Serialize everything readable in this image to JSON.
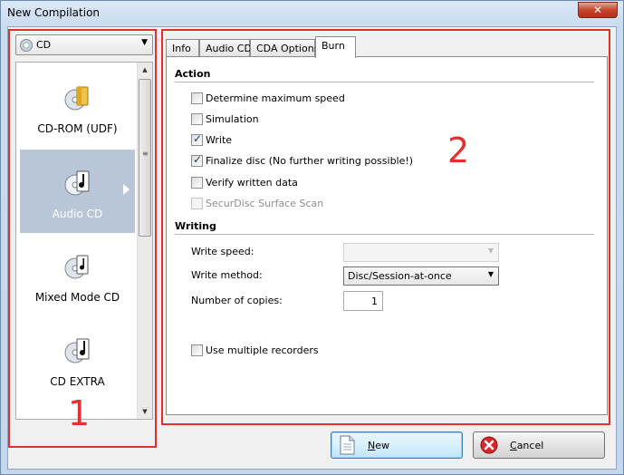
{
  "window": {
    "title": "New Compilation",
    "close_glyph": "✕"
  },
  "disc_type": {
    "selected": "CD",
    "icon": "disc-icon"
  },
  "categories": [
    {
      "label": "CD-ROM (UDF)",
      "icon": "cd-folder-icon"
    },
    {
      "label": "Audio CD",
      "icon": "cd-music-note-icon",
      "selected": true
    },
    {
      "label": "Mixed Mode CD",
      "icon": "cd-music-data-icon"
    },
    {
      "label": "CD EXTRA",
      "icon": "cd-extra-icon"
    }
  ],
  "tabs": [
    {
      "label": "Info"
    },
    {
      "label": "Audio CD"
    },
    {
      "label": "CDA Options"
    },
    {
      "label": "Burn",
      "active": true
    }
  ],
  "burn": {
    "action_title": "Action",
    "options": [
      {
        "label": "Determine maximum speed",
        "checked": false,
        "enabled": true
      },
      {
        "label": "Simulation",
        "checked": false,
        "enabled": true
      },
      {
        "label": "Write",
        "checked": true,
        "enabled": true
      },
      {
        "label": "Finalize disc (No further writing possible!)",
        "checked": true,
        "enabled": true
      },
      {
        "label": "Verify written data",
        "checked": false,
        "enabled": true
      },
      {
        "label": "SecurDisc Surface Scan",
        "checked": false,
        "enabled": false
      }
    ],
    "writing_title": "Writing",
    "write_speed_label": "Write speed:",
    "write_speed_value": "",
    "write_method_label": "Write method:",
    "write_method_value": "Disc/Session-at-once",
    "copies_label": "Number of copies:",
    "copies_value": "1",
    "multiple_recorders_label": "Use multiple recorders",
    "multiple_recorders_checked": false
  },
  "buttons": {
    "new_label": "New",
    "new_underline": "N",
    "new_rest": "ew",
    "cancel_label": "Cancel",
    "cancel_underline": "C",
    "cancel_rest": "ancel"
  },
  "annotations": {
    "left_number": "1",
    "right_number": "2",
    "color": "#e0302f"
  }
}
